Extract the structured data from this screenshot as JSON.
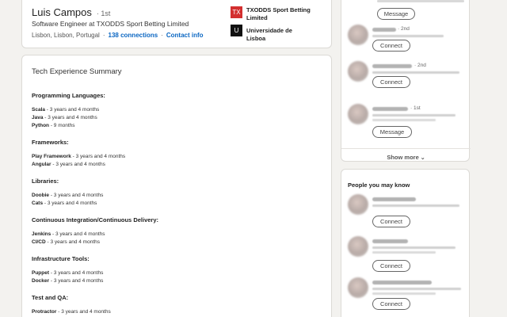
{
  "profile": {
    "name": "Luis Campos",
    "degree": "· 1st",
    "headline": "Software Engineer at TXODDS Sport Betting Limited",
    "location": "Lisbon, Lisbon, Portugal",
    "separator": "·",
    "connections": "138 connections",
    "contact_info": "Contact info",
    "experience_org": {
      "logo_text": "TX",
      "logo_color": "#d32f2f",
      "name": "TXODDS Sport Betting Limited"
    },
    "education_org": {
      "logo_text": "U",
      "logo_color": "#111111",
      "name": "Universidade de Lisboa"
    }
  },
  "about": {
    "title": "Tech Experience Summary",
    "sections": [
      {
        "heading": "Programming Languages:",
        "items": [
          {
            "name": "Scala",
            "duration": " - 3 years and 4 months"
          },
          {
            "name": "Java",
            "duration": " - 3 years and 4 months"
          },
          {
            "name": "Python",
            "duration": " - 9 months"
          }
        ]
      },
      {
        "heading": "Frameworks:",
        "items": [
          {
            "name": "Play Framework",
            "duration": " - 3 years and 4 months"
          },
          {
            "name": "Angular",
            "duration": " - 3 years and 4 months"
          }
        ]
      },
      {
        "heading": "Libraries:",
        "items": [
          {
            "name": "Doobie",
            "duration": " - 3 years and 4 months"
          },
          {
            "name": "Cats",
            "duration": " - 3 years and 4 months"
          }
        ]
      },
      {
        "heading": "Continuous Integration/Continuous Delivery:",
        "items": [
          {
            "name": "Jenkins",
            "duration": " - 3 years and 4 months"
          },
          {
            "name": "CI/CD",
            "duration": " - 3 years and 4 months"
          }
        ]
      },
      {
        "heading": "Infrastructure Tools:",
        "items": [
          {
            "name": "Puppet",
            "duration": " - 3 years and 4 months"
          },
          {
            "name": "Docker",
            "duration": " - 3 years and 4 months"
          }
        ]
      },
      {
        "heading": "Test and QA:",
        "items": [
          {
            "name": "Protractor",
            "duration": " - 3 years and 4 months"
          }
        ]
      }
    ]
  },
  "rail": {
    "people_also_viewed": [
      {
        "degree": "",
        "action": "Message"
      },
      {
        "degree": "· 2nd",
        "action": "Connect"
      },
      {
        "degree": "· 2nd",
        "action": "Connect"
      },
      {
        "degree": "· 1st",
        "action": "Message"
      }
    ],
    "show_more": "Show more",
    "show_more_icon": "chevron-down-icon",
    "pymk_title": "People you may know",
    "people_you_may_know": [
      {
        "action": "Connect"
      },
      {
        "action": "Connect"
      },
      {
        "action": "Connect"
      }
    ]
  }
}
